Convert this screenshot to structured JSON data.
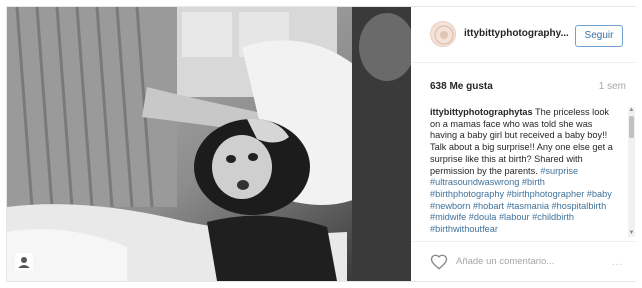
{
  "post": {
    "username": "ittybittyphotography...",
    "follow_label": "Seguir",
    "likes": "638 Me gusta",
    "age": "1 sem",
    "caption_user": "ittybittyphotographytas",
    "caption_text": " The priceless look on a mamas face who was told she was having a baby girl but received a baby boy!! Talk about a big surprise!! Any one else get a surprise like this at birth? Shared with permission by the parents. ",
    "caption_tags": "#surprise #ultrasoundwaswrong #birth #birthphotography #birthphotographer #baby #newborn #hobart #tasmania #hospitalbirth #midwife #doula #labour #childbirth #birthwithoutfear",
    "comment_placeholder": "Añade un comentario...",
    "more_label": "..."
  },
  "icons": {
    "photo_tag": "user-tag-icon",
    "like": "heart-icon",
    "more": "more-options-icon"
  }
}
